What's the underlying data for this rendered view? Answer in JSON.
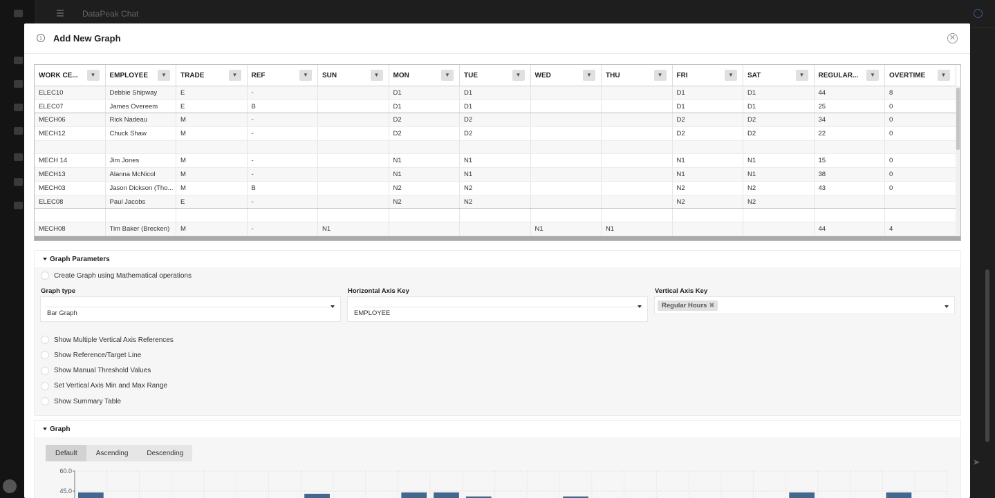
{
  "background_app": {
    "title": "DataPeak Chat"
  },
  "modal": {
    "title": "Add New Graph"
  },
  "grid": {
    "columns": [
      "WORK CE...",
      "EMPLOYEE",
      "TRADE",
      "REF",
      "SUN",
      "MON",
      "TUE",
      "WED",
      "THU",
      "FRI",
      "SAT",
      "REGULAR...",
      "OVERTIME"
    ],
    "rows": [
      [
        "ELEC10",
        "Debbie Shipway",
        "E",
        "-",
        "",
        "D1",
        "D1",
        "",
        "",
        "D1",
        "D1",
        "44",
        "8"
      ],
      [
        "ELEC07",
        "James Overeem",
        "E",
        "B",
        "",
        "D1",
        "D1",
        "",
        "",
        "D1",
        "D1",
        "25",
        "0"
      ],
      [
        "MECH06",
        "Rick Nadeau",
        "M",
        "-",
        "",
        "D2",
        "D2",
        "",
        "",
        "D2",
        "D2",
        "34",
        "0"
      ],
      [
        "MECH12",
        "Chuck Shaw",
        "M",
        "-",
        "",
        "D2",
        "D2",
        "",
        "",
        "D2",
        "D2",
        "22",
        "0"
      ],
      [
        "",
        "",
        "",
        "",
        "",
        "",
        "",
        "",
        "",
        "",
        "",
        "",
        ""
      ],
      [
        "MECH 14",
        "Jim Jones",
        "M",
        "-",
        "",
        "N1",
        "N1",
        "",
        "",
        "N1",
        "N1",
        "15",
        "0"
      ],
      [
        "MECH13",
        "Alanna McNicol",
        "M",
        "-",
        "",
        "N1",
        "N1",
        "",
        "",
        "N1",
        "N1",
        "38",
        "0"
      ],
      [
        "MECH03",
        "Jason Dickson (Tho...",
        "M",
        "B",
        "",
        "N2",
        "N2",
        "",
        "",
        "N2",
        "N2",
        "43",
        "0"
      ],
      [
        "ELEC08",
        "Paul Jacobs",
        "E",
        "-",
        "",
        "N2",
        "N2",
        "",
        "",
        "N2",
        "N2",
        "",
        ""
      ],
      [
        "",
        "",
        "",
        "",
        "",
        "",
        "",
        "",
        "",
        "",
        "",
        "",
        ""
      ],
      [
        "MECH08",
        "Tim Baker (Brecken)",
        "M",
        "-",
        "N1",
        "",
        "",
        "N1",
        "N1",
        "",
        "",
        "44",
        "4"
      ]
    ]
  },
  "params": {
    "section_title": "Graph Parameters",
    "math_ops_label": "Create Graph using Mathematical operations",
    "graph_type_label": "Graph type",
    "graph_type_value": "Bar Graph",
    "h_axis_label": "Horizontal Axis Key",
    "h_axis_value": "EMPLOYEE",
    "v_axis_label": "Vertical Axis Key",
    "v_axis_chip": "Regular Hours",
    "options": [
      "Show Multiple Vertical Axis References",
      "Show Reference/Target Line",
      "Show Manual Threshold Values",
      "Set Vertical Axis Min and Max Range",
      "Show Summary Table"
    ]
  },
  "graph": {
    "section_title": "Graph",
    "sort_buttons": [
      "Default",
      "Ascending",
      "Descending"
    ],
    "active_sort": "Default"
  },
  "chart_data": {
    "type": "bar",
    "title": "",
    "y_ticks": [
      "60.0",
      "45.0"
    ],
    "series": [
      {
        "name": "Regular Hours",
        "color": "#44678f",
        "values": [
          44,
          0,
          0,
          0,
          0,
          0,
          39,
          43,
          0,
          0,
          44,
          44,
          41,
          0,
          0,
          41,
          0,
          0,
          0,
          0,
          0,
          0,
          44,
          0,
          0,
          44,
          0
        ]
      }
    ]
  }
}
